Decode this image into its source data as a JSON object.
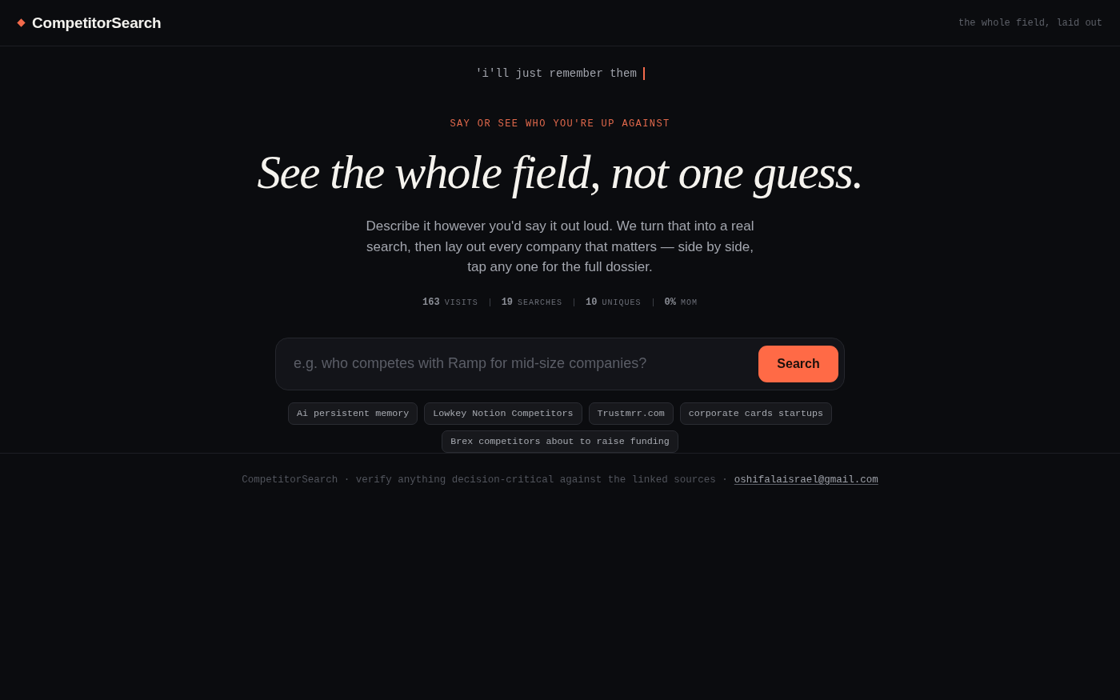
{
  "header": {
    "brand": "CompetitorSearch",
    "tagline": "the whole field, laid out"
  },
  "hero": {
    "typed_line": "'i'll just remember them",
    "eyebrow": "SAY OR SEE WHO YOU'RE UP AGAINST",
    "headline": "See the whole field, not one guess.",
    "description": "Describe it however you'd say it out loud. We turn that into a real search, then lay out every company that matters — side by side, tap any one for the full dossier.",
    "stats": [
      {
        "value": "163",
        "label": "VISITS"
      },
      {
        "value": "19",
        "label": "SEARCHES"
      },
      {
        "value": "10",
        "label": "UNIQUES"
      },
      {
        "value": "0%",
        "label": "MOM"
      }
    ]
  },
  "search": {
    "placeholder": "e.g. who competes with Ramp for mid-size companies?",
    "button": "Search"
  },
  "suggestions": [
    "Ai persistent memory",
    "Lowkey Notion Competitors",
    "Trustmrr.com",
    "corporate cards startups",
    "Brex competitors about to raise funding"
  ],
  "footer": {
    "note": "CompetitorSearch · verify anything decision-critical against the linked sources ·",
    "email": "oshifalaisrael@gmail.com"
  }
}
